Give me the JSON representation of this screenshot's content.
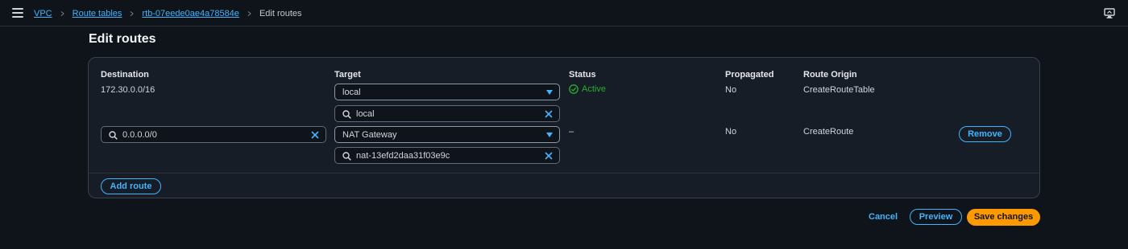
{
  "breadcrumb": {
    "items": [
      "VPC",
      "Route tables",
      "rtb-07eede0ae4a78584e"
    ],
    "current": "Edit routes"
  },
  "page": {
    "title": "Edit routes"
  },
  "table": {
    "headers": {
      "destination": "Destination",
      "target": "Target",
      "status": "Status",
      "propagated": "Propagated",
      "route_origin": "Route Origin"
    },
    "rows": [
      {
        "destination": "172.30.0.0/16",
        "target_type": "local",
        "target_value": "local",
        "status": "Active",
        "propagated": "No",
        "route_origin": "CreateRouteTable"
      },
      {
        "destination": "0.0.0.0/0",
        "target_type": "NAT Gateway",
        "target_value": "nat-13efd2daa31f03e9c",
        "status": "–",
        "propagated": "No",
        "route_origin": "CreateRoute",
        "remove_label": "Remove"
      }
    ]
  },
  "actions": {
    "add_route": "Add route",
    "cancel": "Cancel",
    "preview": "Preview",
    "save": "Save changes"
  },
  "icons": {
    "menu": "hamburger-menu-icon",
    "breadcrumb_separator": "chevron-right-icon",
    "top_right": "screen-share-icon",
    "search": "search-icon",
    "clear": "close-icon",
    "dropdown": "caret-down-icon",
    "status": "check-circle-icon"
  },
  "colors": {
    "background": "#0f141a",
    "panel": "#161d26",
    "link": "#42b4ff",
    "primary": "#ff9900",
    "success": "#29ad32"
  }
}
